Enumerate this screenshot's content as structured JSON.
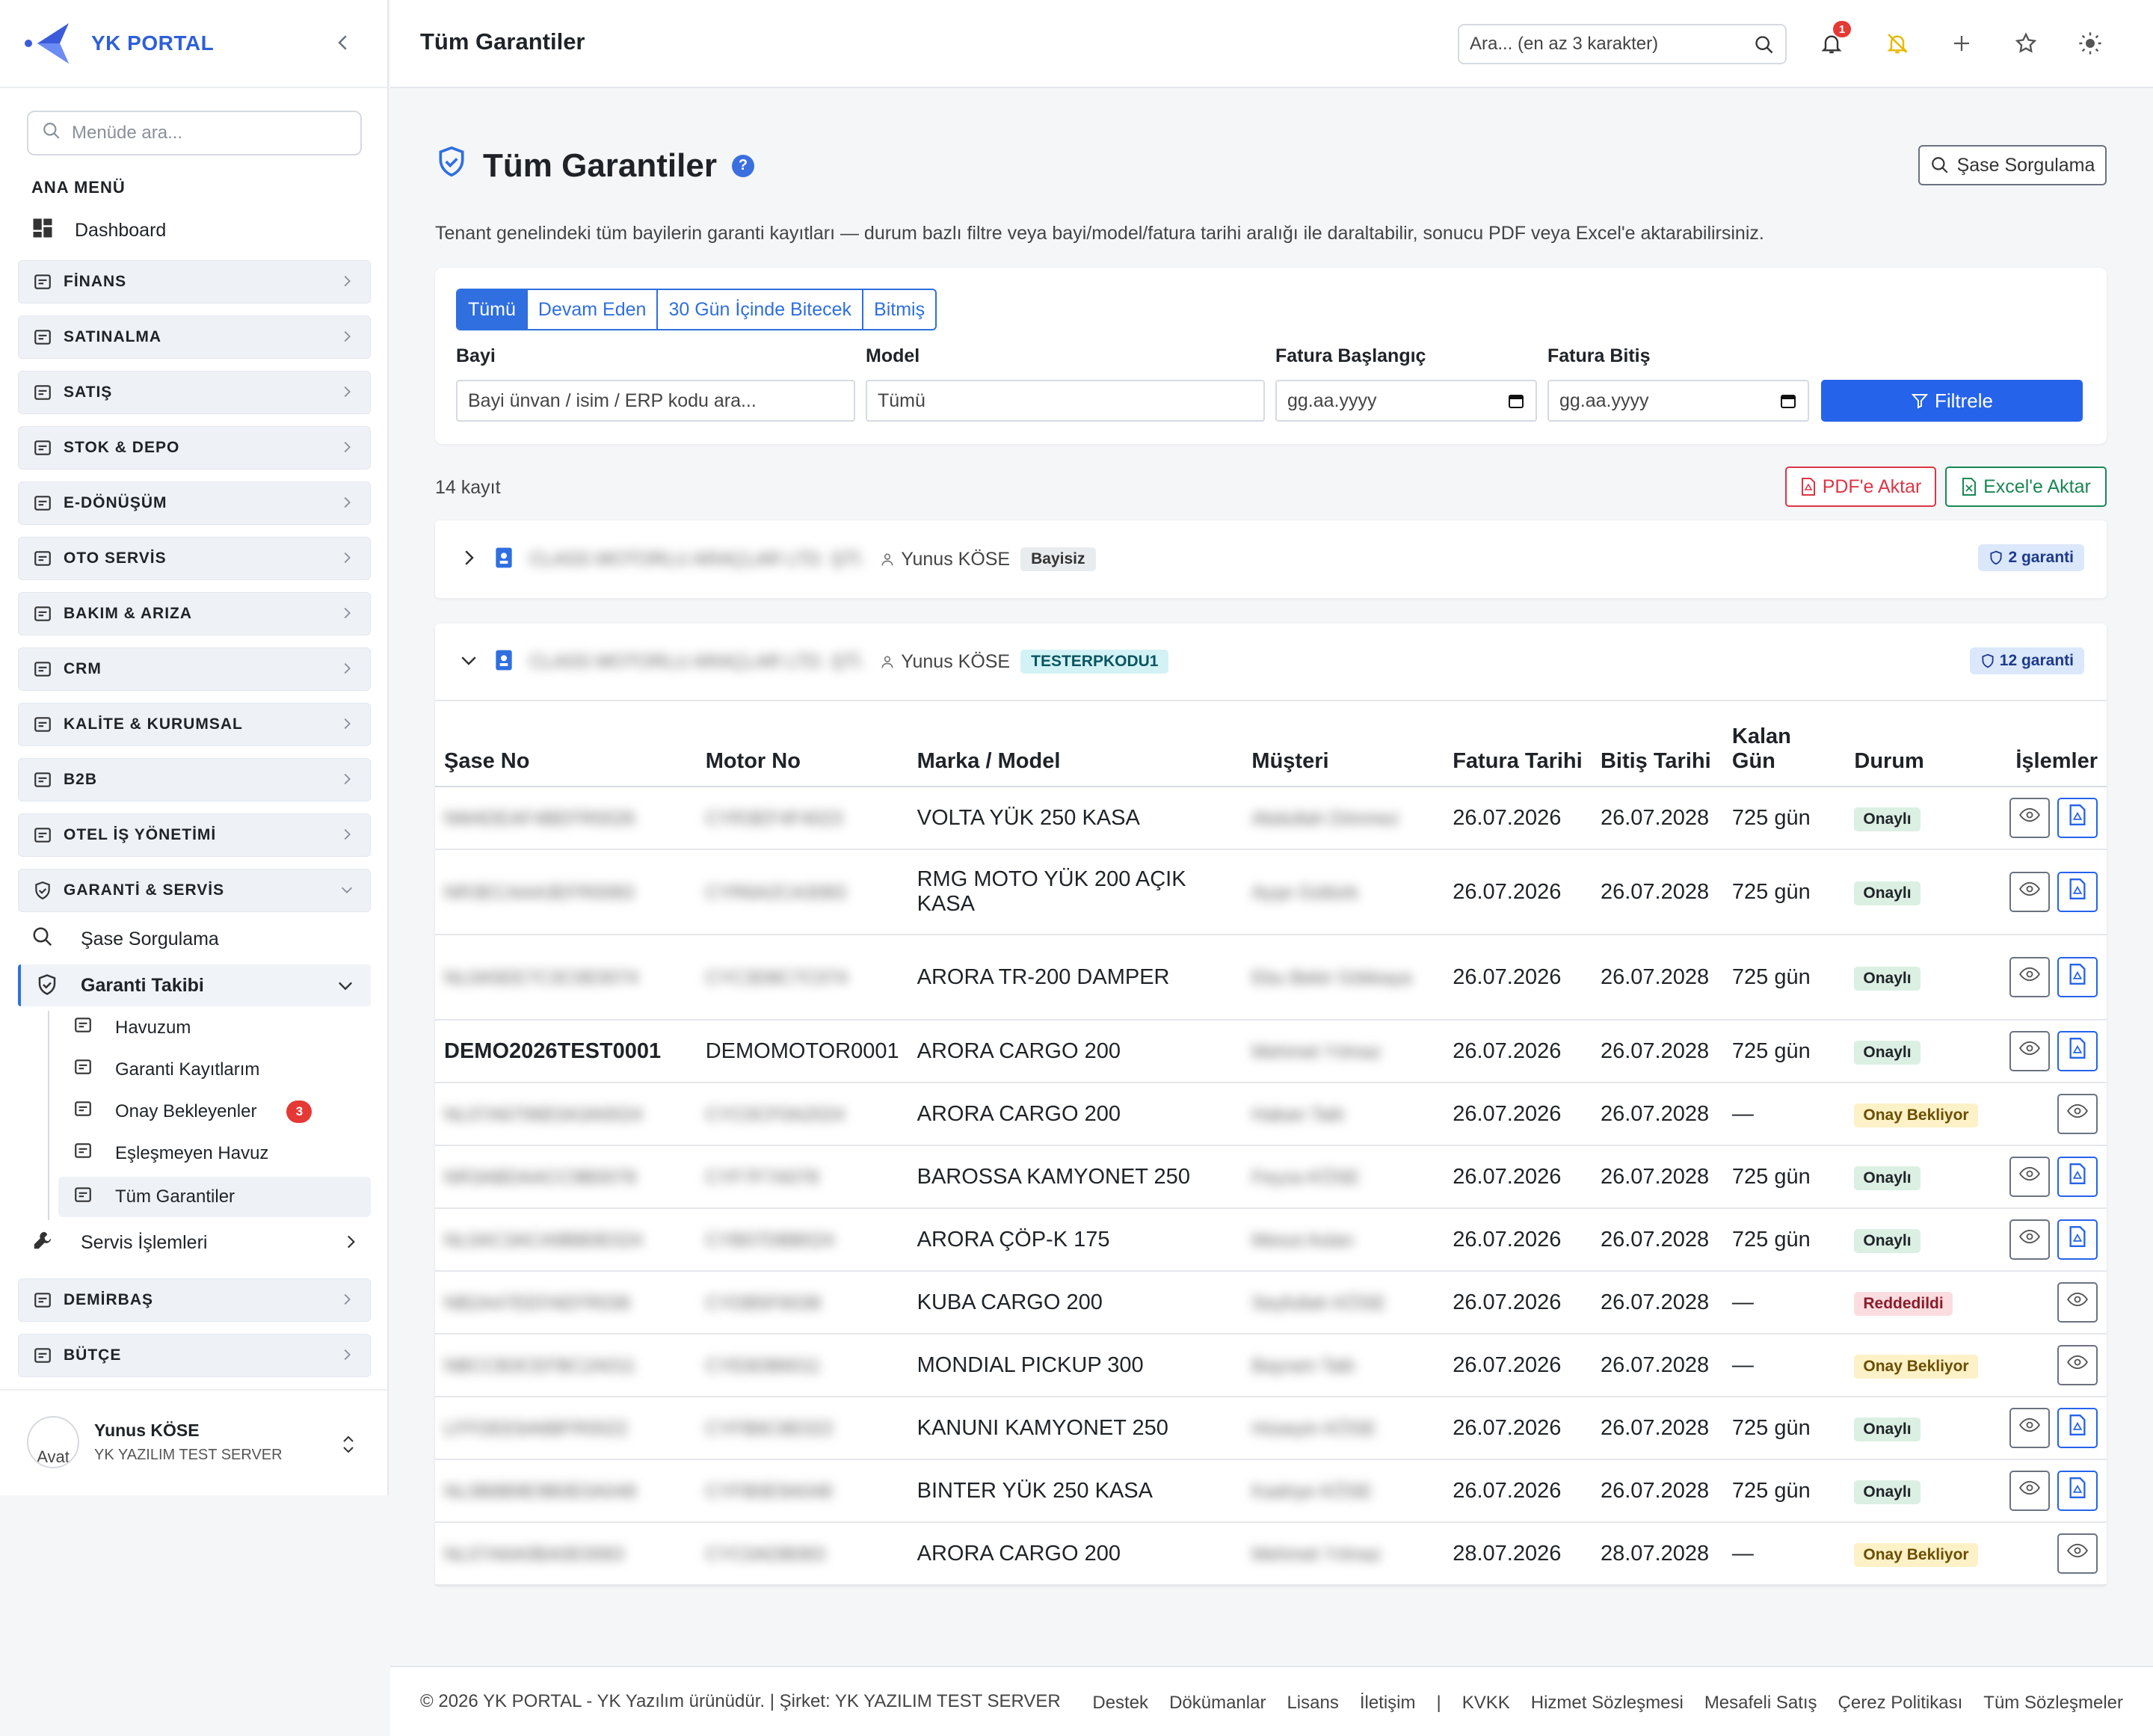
{
  "brand": "YK PORTAL",
  "sidebar": {
    "search_placeholder": "Menüde ara...",
    "section_title": "ANA MENÜ",
    "dashboard": "Dashboard",
    "groups": [
      {
        "label": "FİNANS",
        "icon": "finance-icon"
      },
      {
        "label": "SATINALMA",
        "icon": "cart-icon"
      },
      {
        "label": "SATIŞ",
        "icon": "tag-icon"
      },
      {
        "label": "STOK & DEPO",
        "icon": "box-icon"
      },
      {
        "label": "E-DÖNÜŞÜM",
        "icon": "document-icon"
      },
      {
        "label": "OTO SERVİS",
        "icon": "car-icon"
      },
      {
        "label": "BAKIM & ARIZA",
        "icon": "tools-icon"
      },
      {
        "label": "CRM",
        "icon": "headset-icon"
      },
      {
        "label": "KALİTE & KURUMSAL",
        "icon": "badge-icon"
      },
      {
        "label": "B2B",
        "icon": "globe-icon"
      },
      {
        "label": "OTEL İŞ YÖNETİMİ",
        "icon": "building-icon"
      },
      {
        "label": "GARANTİ & SERVİS",
        "icon": "shield-icon"
      }
    ],
    "garanti_sub": {
      "sase": "Şase Sorgulama",
      "takibi": "Garanti Takibi",
      "servis": "Servis İşlemleri"
    },
    "takibi_items": [
      {
        "label": "Havuzum",
        "icon": "inbox-icon"
      },
      {
        "label": "Garanti Kayıtlarım",
        "icon": "card-list-icon"
      },
      {
        "label": "Onay Bekleyenler",
        "icon": "check-square-icon",
        "badge": "3"
      },
      {
        "label": "Eşleşmeyen Havuz",
        "icon": "diamond-icon"
      },
      {
        "label": "Tüm Garantiler",
        "icon": "list-icon"
      }
    ],
    "bottom_groups": [
      {
        "label": "DEMİRBAŞ",
        "icon": "cube-icon"
      },
      {
        "label": "BÜTÇE",
        "icon": "wallet-icon"
      }
    ],
    "user": {
      "name": "Yunus KÖSE",
      "company": "YK YAZILIM TEST SERVER",
      "avatar_alt": "Avat"
    }
  },
  "topbar": {
    "title": "Tüm Garantiler",
    "search_placeholder": "Ara... (en az 3 karakter)",
    "notif_count": "1"
  },
  "page": {
    "title": "Tüm Garantiler",
    "help": "?",
    "sase_button": "Şase Sorgulama",
    "description": "Tenant genelindeki tüm bayilerin garanti kayıtları — durum bazlı filtre veya bayi/model/fatura tarihi aralığı ile daraltabilir, sonucu PDF veya Excel'e aktarabilirsiniz.",
    "tabs": [
      "Tümü",
      "Devam Eden",
      "30 Gün İçinde Bitecek",
      "Bitmiş"
    ],
    "filters": {
      "bayi_label": "Bayi",
      "bayi_placeholder": "Bayi ünvan / isim / ERP kodu ara...",
      "model_label": "Model",
      "model_value": "Tümü",
      "start_label": "Fatura Başlangıç",
      "start_value": "gg.aa.yyyy",
      "end_label": "Fatura Bitiş",
      "end_value": "gg.aa.yyyy",
      "filter_button": "Filtrele"
    },
    "count": "14 kayıt",
    "pdf_button": "PDF'e Aktar",
    "excel_button": "Excel'e Aktar"
  },
  "dealers": [
    {
      "name": "CLASS MOTORLU ARAÇLAR LTD. ŞTİ.",
      "user": "Yunus KÖSE",
      "tag": "Bayisiz",
      "count": "2 garanti"
    },
    {
      "name": "CLASS MOTORLU ARAÇLAR LTD. ŞTİ.",
      "user": "Yunus KÖSE",
      "tag": "TESTERPKODU1",
      "count": "12 garanti"
    }
  ],
  "table": {
    "headers": [
      "Şase No",
      "Motor No",
      "Marka / Model",
      "Müşteri",
      "Fatura Tarihi",
      "Bitiş Tarihi",
      "Kalan Gün",
      "Durum",
      "İşlemler"
    ],
    "rows": [
      {
        "sase": "NM4DEAF4BEFR0026",
        "motor": "CYR3EF4F4023",
        "model": "VOLTA YÜK 250 KASA",
        "musteri": "Abdullah Dönmez",
        "fatura": "26.07.2026",
        "bitis": "26.07.2028",
        "kalan": "725 gün",
        "durum": "Onaylı",
        "type": "ok",
        "pdf": true
      },
      {
        "sase": "NR3ECAAA3EFR0083",
        "motor": "CYR6A2CA3083",
        "model": "RMG MOTO YÜK 200 AÇIK KASA",
        "musteri": "Ayşe Gültürk",
        "fatura": "26.07.2026",
        "bitis": "26.07.2028",
        "kalan": "725 gün",
        "durum": "Onaylı",
        "type": "ok",
        "pdf": true
      },
      {
        "sase": "NL0A5EE7C3C0E0074",
        "motor": "CYC3D8C7C074",
        "model": "ARORA TR-200 DAMPER",
        "musteri": "Ebu Bekir Gökkaya",
        "fatura": "26.07.2026",
        "bitis": "26.07.2028",
        "kalan": "725 gün",
        "durum": "Onaylı",
        "type": "ok",
        "pdf": true
      },
      {
        "sase": "DEMO2026TEST0001",
        "motor": "DEMOMOTOR0001",
        "model": "ARORA CARGO 200",
        "musteri": "Mehmet Yılmaz",
        "fatura": "26.07.2026",
        "bitis": "26.07.2028",
        "kalan": "725 gün",
        "durum": "Onaylı",
        "type": "ok",
        "pdf": true,
        "clear": true
      },
      {
        "sase": "NL07A6706E0A3A0024",
        "motor": "CYC0CF0A2024",
        "model": "ARORA CARGO 200",
        "musteri": "Hakan Tatlı",
        "fatura": "26.07.2026",
        "bitis": "26.07.2028",
        "kalan": "—",
        "durum": "Onay Bekliyor",
        "type": "wait",
        "pdf": false
      },
      {
        "sase": "NR3ABDAACC9B0078",
        "motor": "CYF7F7A078",
        "model": "BAROSSA KAMYONET 250",
        "musteri": "Feyza KÖSE",
        "fatura": "26.07.2026",
        "bitis": "26.07.2028",
        "kalan": "725 gün",
        "durum": "Onaylı",
        "type": "ok",
        "pdf": true
      },
      {
        "sase": "NL0AC3ACA9BB0E024",
        "motor": "CYB07DBB024",
        "model": "ARORA ÇÖP-K 175",
        "musteri": "Mesut Aslan",
        "fatura": "26.07.2026",
        "bitis": "26.07.2028",
        "kalan": "725 gün",
        "durum": "Onaylı",
        "type": "ok",
        "pdf": true
      },
      {
        "sase": "NB2A47EEFAEFR038",
        "motor": "CYDB5F6038",
        "model": "KUBA CARGO 200",
        "musteri": "Seyfullah KÖSE",
        "fatura": "26.07.2026",
        "bitis": "26.07.2028",
        "kalan": "—",
        "durum": "Reddedildi",
        "type": "rej",
        "pdf": false
      },
      {
        "sase": "NBCCB3CEFBC2A011",
        "motor": "CYE6DB6011",
        "model": "MONDIAL PICKUP 300",
        "musteri": "Bayram Tatlı",
        "fatura": "26.07.2026",
        "bitis": "26.07.2028",
        "kalan": "—",
        "durum": "Onay Bekliyor",
        "type": "wait",
        "pdf": false
      },
      {
        "sase": "LFFDEE6A6BFR0022",
        "motor": "CYFB6C8E022",
        "model": "KANUNI KAMYONET 250",
        "musteri": "Hüseyin KÖSE",
        "fatura": "26.07.2026",
        "bitis": "26.07.2028",
        "kalan": "725 gün",
        "durum": "Onaylı",
        "type": "ok",
        "pdf": true
      },
      {
        "sase": "NL0B8B9E9B0E0A048",
        "motor": "CYFB0E9A048",
        "model": "BINTER YÜK 250 KASA",
        "musteri": "Kadriye KÖSE",
        "fatura": "26.07.2026",
        "bitis": "26.07.2028",
        "kalan": "725 gün",
        "durum": "Onaylı",
        "type": "ok",
        "pdf": true
      },
      {
        "sase": "NL07A6A0BA0E0083",
        "motor": "CYC0ADB083",
        "model": "ARORA CARGO 200",
        "musteri": "Mehmet Yılmaz",
        "fatura": "28.07.2026",
        "bitis": "28.07.2028",
        "kalan": "—",
        "durum": "Onay Bekliyor",
        "type": "wait",
        "pdf": false
      }
    ]
  },
  "footer": {
    "copy": "© 2026 YK PORTAL - YK Yazılım ürünüdür. | Şirket: YK YAZILIM TEST SERVER",
    "links": [
      "Destek",
      "Dökümanlar",
      "Lisans",
      "İletişim",
      "|",
      "KVKK",
      "Hizmet Sözleşmesi",
      "Mesafeli Satış",
      "Çerez Politikası",
      "Tüm Sözleşmeler"
    ]
  }
}
